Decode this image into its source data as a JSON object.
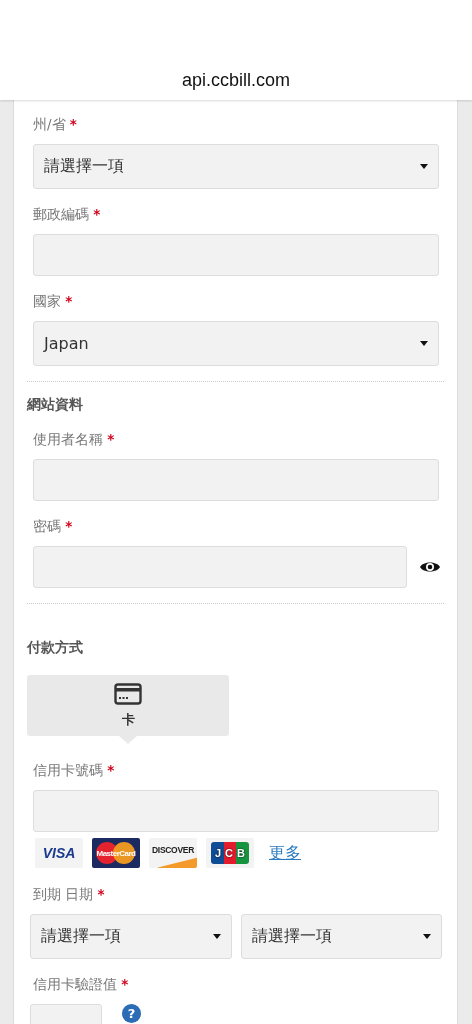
{
  "address_bar": {
    "url": "api.ccbill.com"
  },
  "form": [
    {
      "kind": "select",
      "label": "州/省",
      "required_mark": "*",
      "value": "請選擇一項"
    },
    {
      "kind": "input",
      "label": "郵政編碼",
      "required_mark": "*"
    },
    {
      "kind": "select",
      "label": "國家",
      "required_mark": "*",
      "value": "Japan"
    },
    {
      "kind": "divider"
    },
    {
      "kind": "heading",
      "text": "網站資料"
    },
    {
      "kind": "input",
      "label": "使用者名稱",
      "required_mark": "*"
    },
    {
      "kind": "password",
      "label": "密碼",
      "required_mark": "*"
    },
    {
      "kind": "divider"
    },
    {
      "kind": "heading",
      "text": "付款方式"
    },
    {
      "kind": "methods",
      "methods": [
        {
          "label": "卡",
          "selected": true
        }
      ]
    },
    {
      "kind": "card_number",
      "label": "信用卡號碼",
      "required_mark": "*",
      "brands": [
        {
          "kind": "visa",
          "text": "VISA"
        },
        {
          "kind": "mastercard",
          "text": "MasterCard"
        },
        {
          "kind": "discover",
          "text": "DISCOVER"
        },
        {
          "kind": "jcb",
          "text": "JCB"
        }
      ],
      "more_link": "更多"
    },
    {
      "kind": "select_pair",
      "label": "到期 日期",
      "required_mark": "*",
      "values": [
        "請選擇一項",
        "請選擇一項"
      ]
    },
    {
      "kind": "cvv",
      "label": "信用卡驗證值",
      "required_mark": "*",
      "help": "?"
    }
  ]
}
